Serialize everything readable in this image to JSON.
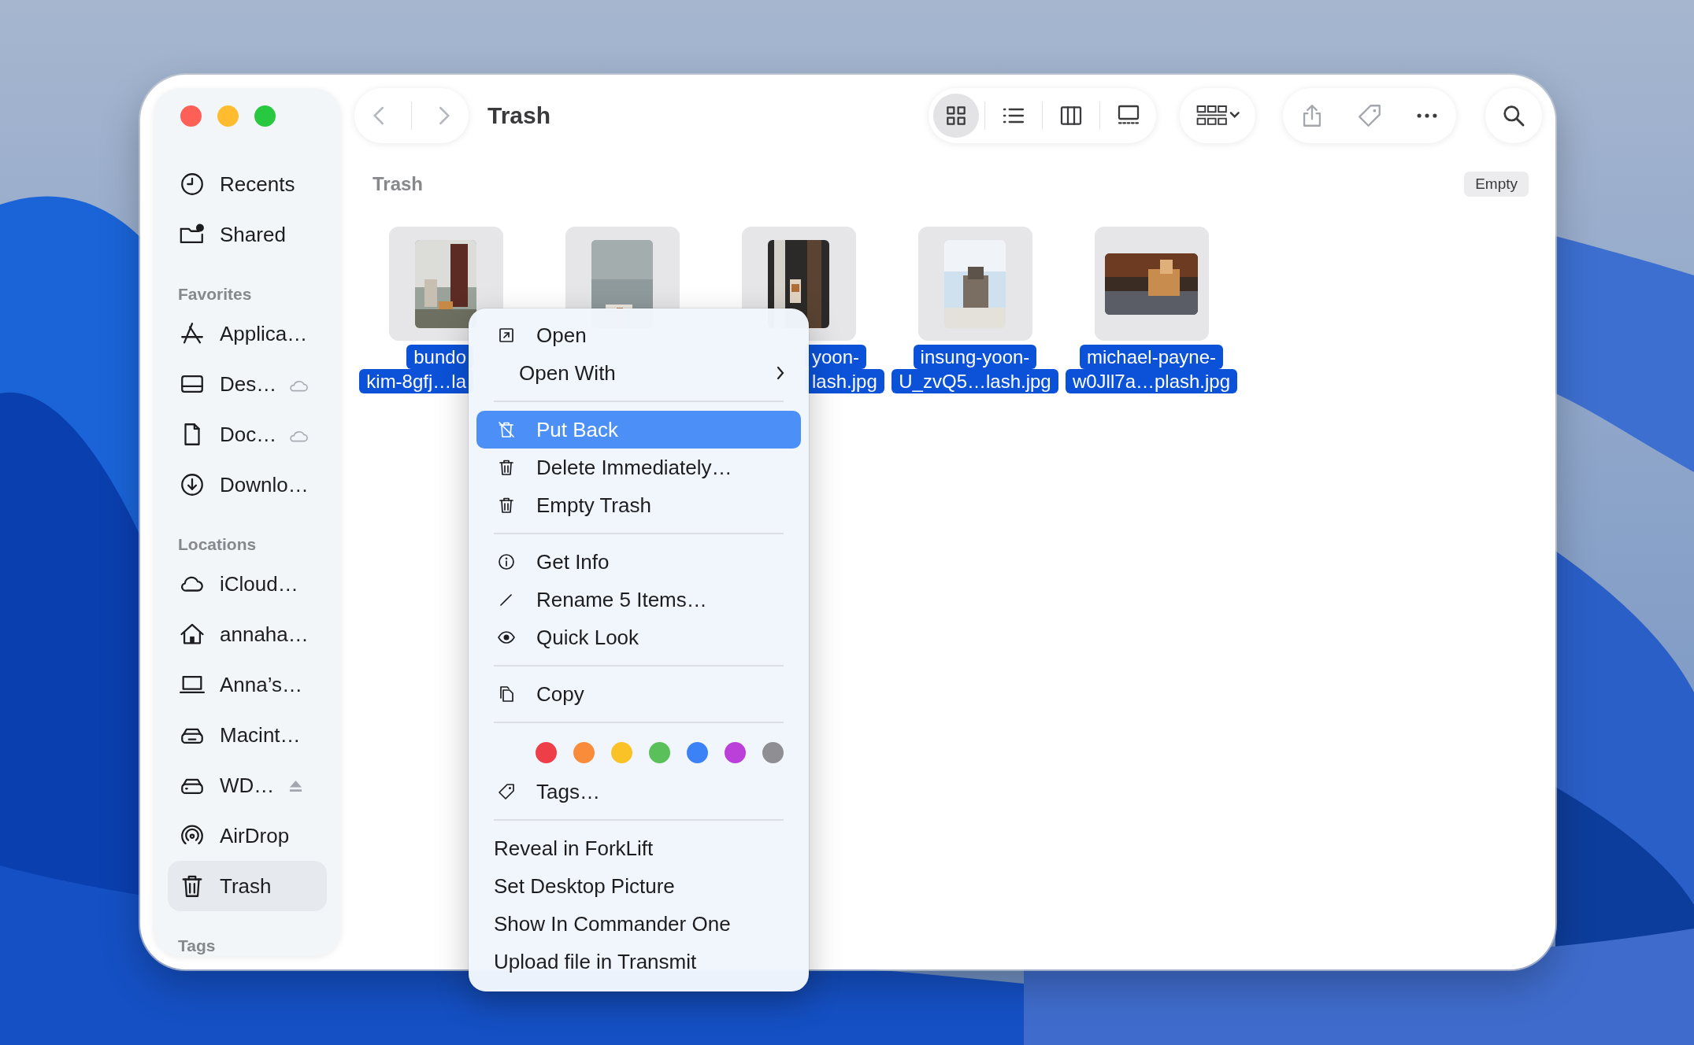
{
  "window": {
    "title": "Trash"
  },
  "traffic_lights": [
    {
      "color": "#fe5f57"
    },
    {
      "color": "#febc2e"
    },
    {
      "color": "#28c840"
    }
  ],
  "sidebar": {
    "sections": [
      {
        "items": [
          {
            "label": "Recents",
            "kind": "clock",
            "selected": false
          },
          {
            "label": "Shared",
            "kind": "shared",
            "selected": false
          }
        ]
      },
      {
        "header": "Favorites",
        "items": [
          {
            "label": "Applica…",
            "kind": "apps",
            "selected": false
          },
          {
            "label": "Des…",
            "kind": "desktop",
            "icloud": true,
            "selected": false
          },
          {
            "label": "Doc…",
            "kind": "document",
            "icloud": true,
            "selected": false
          },
          {
            "label": "Downlo…",
            "kind": "download",
            "selected": false
          }
        ]
      },
      {
        "header": "Locations",
        "items": [
          {
            "label": "iCloud…",
            "kind": "cloud",
            "selected": false
          },
          {
            "label": "annaha…",
            "kind": "home",
            "selected": false
          },
          {
            "label": "Anna’s…",
            "kind": "laptop",
            "selected": false
          },
          {
            "label": "Macint…",
            "kind": "disk",
            "selected": false
          },
          {
            "label": "WD…",
            "kind": "drive",
            "eject": true,
            "selected": false
          },
          {
            "label": "AirDrop",
            "kind": "airdrop",
            "selected": false
          },
          {
            "label": "Trash",
            "kind": "trash",
            "selected": true
          }
        ]
      },
      {
        "header": "Tags"
      }
    ]
  },
  "toolbar": {
    "view_modes": [
      {
        "kind": "icons",
        "selected": true
      },
      {
        "kind": "list",
        "selected": false
      },
      {
        "kind": "columns",
        "selected": false
      },
      {
        "kind": "gallery",
        "selected": false
      }
    ]
  },
  "content": {
    "header": "Trash",
    "empty_button": "Empty",
    "files": [
      {
        "name_lines": [
          "bundo",
          "kim-8gfj…la"
        ],
        "selected": true
      },
      {
        "selected": true
      },
      {
        "name_lines": [
          "yoon-",
          "lash.jpg"
        ],
        "selected": true
      },
      {
        "name_lines": [
          "insung-yoon-",
          "U_zvQ5…lash.jpg"
        ],
        "selected": true
      },
      {
        "name_lines": [
          "michael-payne-",
          "w0Jll7a…plash.jpg"
        ],
        "selected": true
      }
    ]
  },
  "context_menu": {
    "items": [
      {
        "kind": "open",
        "label": "Open",
        "highlighted": false
      },
      {
        "kind": "submenu",
        "label": "Open With",
        "highlighted": false
      },
      {
        "kind": "separator"
      },
      {
        "kind": "restore",
        "label": "Put Back",
        "highlighted": true
      },
      {
        "kind": "trash",
        "label": "Delete Immediately…",
        "highlighted": false
      },
      {
        "kind": "trash",
        "label": "Empty Trash",
        "highlighted": false
      },
      {
        "kind": "separator"
      },
      {
        "kind": "info",
        "label": "Get Info",
        "highlighted": false
      },
      {
        "kind": "pencil",
        "label": "Rename 5 Items…",
        "highlighted": false
      },
      {
        "kind": "eye",
        "label": "Quick Look",
        "highlighted": false
      },
      {
        "kind": "separator"
      },
      {
        "kind": "copy",
        "label": "Copy",
        "highlighted": false
      },
      {
        "kind": "separator"
      },
      {
        "kind": "colors",
        "colors": [
          {
            "color": "#ee3e48"
          },
          {
            "color": "#f98c3a"
          },
          {
            "color": "#fac227"
          },
          {
            "color": "#5ac05a"
          },
          {
            "color": "#3b82f6"
          },
          {
            "color": "#bb3fd9"
          },
          {
            "color": "#8e8e93"
          }
        ]
      },
      {
        "kind": "tag",
        "label": "Tags…",
        "highlighted": false
      },
      {
        "kind": "separator"
      },
      {
        "kind": "text",
        "label": "Reveal in ForkLift",
        "highlighted": false
      },
      {
        "kind": "text",
        "label": "Set Desktop Picture",
        "highlighted": false
      },
      {
        "kind": "text",
        "label": "Show In Commander One",
        "highlighted": false
      },
      {
        "kind": "text",
        "label": "Upload file in Transmit",
        "highlighted": false
      }
    ]
  }
}
